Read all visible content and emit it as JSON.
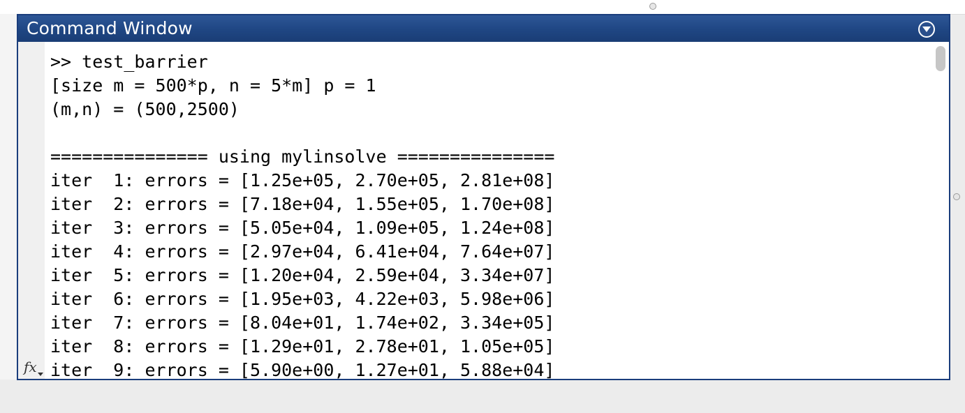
{
  "window": {
    "title": "Command Window"
  },
  "prompt": {
    "symbol": ">>",
    "command": "test_barrier"
  },
  "output_lines": [
    "[size m = 500*p, n = 5*m] p = 1",
    "(m,n) = (500,2500)",
    "",
    "=============== using mylinsolve ===============",
    "iter  1: errors = [1.25e+05, 2.70e+05, 2.81e+08]",
    "iter  2: errors = [7.18e+04, 1.55e+05, 1.70e+08]",
    "iter  3: errors = [5.05e+04, 1.09e+05, 1.24e+08]",
    "iter  4: errors = [2.97e+04, 6.41e+04, 7.64e+07]",
    "iter  5: errors = [1.20e+04, 2.59e+04, 3.34e+07]",
    "iter  6: errors = [1.95e+03, 4.22e+03, 5.98e+06]",
    "iter  7: errors = [8.04e+01, 1.74e+02, 3.34e+05]",
    "iter  8: errors = [1.29e+01, 2.78e+01, 1.05e+05]",
    "iter  9: errors = [5.90e+00, 1.27e+01, 5.88e+04]"
  ],
  "gutter": {
    "fx_label": "fx"
  },
  "icons": {
    "panel_menu": "chevron-down-circle-icon",
    "function_browser": "fx-icon"
  },
  "colors": {
    "header": "#1f4683",
    "border": "#1a3d7c"
  }
}
